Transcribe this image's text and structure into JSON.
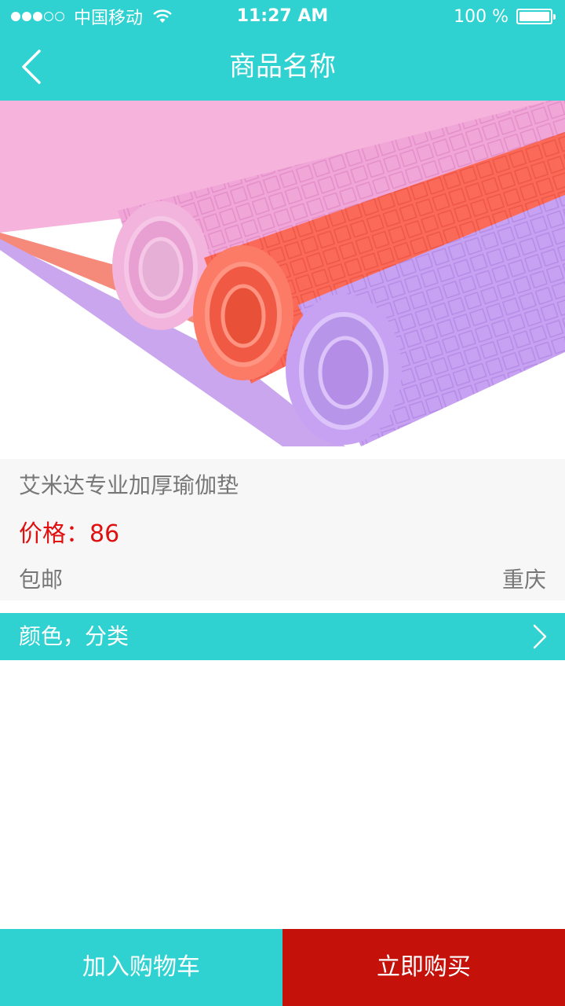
{
  "status_bar": {
    "carrier": "中国移动",
    "time": "11:27 AM",
    "battery": "100 %"
  },
  "nav": {
    "title": "商品名称",
    "back_icon": "chevron-left-icon"
  },
  "product": {
    "name": "艾米达专业加厚瑜伽垫",
    "price": "价格：86",
    "shipping": "包邮",
    "location": "重庆"
  },
  "options": {
    "label": "颜色，分类",
    "chevron_icon": "chevron-right-icon"
  },
  "footer": {
    "add_to_cart": "加入购物车",
    "buy_now": "立即购买"
  },
  "colors": {
    "accent": "#2fd1d1",
    "buy": "#c4110a",
    "price": "#e01010"
  }
}
